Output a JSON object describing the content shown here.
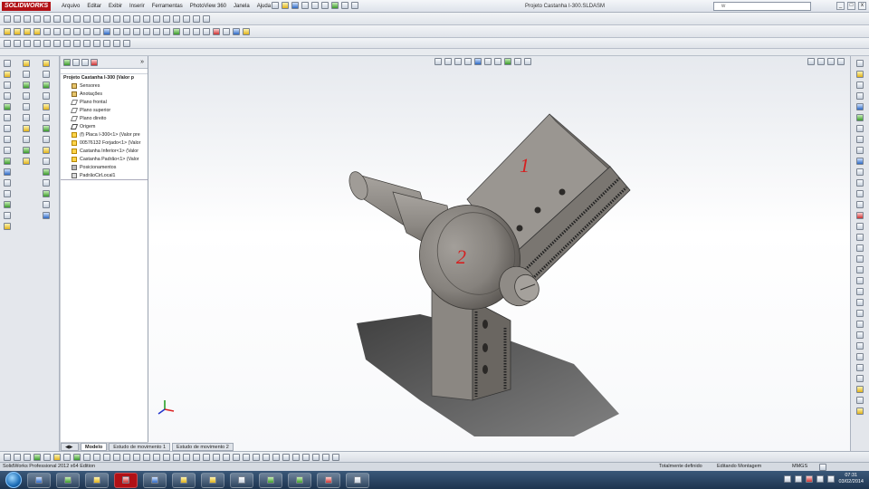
{
  "app": {
    "logo": "SOLIDWORKS",
    "title": "Projeto Castanha I-300.SLDASM",
    "search_value": "w"
  },
  "menu": [
    "Arquivo",
    "Editar",
    "Exibir",
    "Inserir",
    "Ferramentas",
    "PhotoView 360",
    "Janela",
    "Ajuda"
  ],
  "window_controls": [
    "_",
    "□",
    "x"
  ],
  "tree": {
    "root": "Projeto Castanha I-300  (Valor p",
    "items": [
      {
        "label": "Sensores",
        "icon": "sensor-icon"
      },
      {
        "label": "Anotações",
        "icon": "annotation-icon"
      },
      {
        "label": "Plano frontal",
        "icon": "plane-icon"
      },
      {
        "label": "Plano superior",
        "icon": "plane-icon"
      },
      {
        "label": "Plano direito",
        "icon": "plane-icon"
      },
      {
        "label": "Origem",
        "icon": "origin-icon"
      },
      {
        "label": "(f) Placa I-300<1> (Valor pre",
        "icon": "part-icon"
      },
      {
        "label": "00576132 Forjado<1> (Valor",
        "icon": "part-icon"
      },
      {
        "label": "Castanha Inferior<1> (Valor",
        "icon": "part-icon"
      },
      {
        "label": "Castanha Padrão<1> (Valor",
        "icon": "part-icon"
      },
      {
        "label": "Posicionamentos",
        "icon": "mates-icon"
      },
      {
        "label": "PadrãoCirLocal1",
        "icon": "pattern-icon"
      }
    ]
  },
  "viewport": {
    "labels": [
      "1",
      "2"
    ],
    "colors": {
      "part": "#8e8a86",
      "part_dark": "#5e5a56",
      "label": "#d62020"
    }
  },
  "bottom_tabs": [
    "Modelo",
    "Estudo de movimento 1",
    "Estudo de movimento 2"
  ],
  "status": {
    "app_edition": "SolidWorks Professional 2012 x64 Edition",
    "definition": "Totalmente definido",
    "mode": "Editando Montagem",
    "units": "MMGS"
  },
  "clock": {
    "time": "07:31",
    "date": "03/02/2014"
  }
}
